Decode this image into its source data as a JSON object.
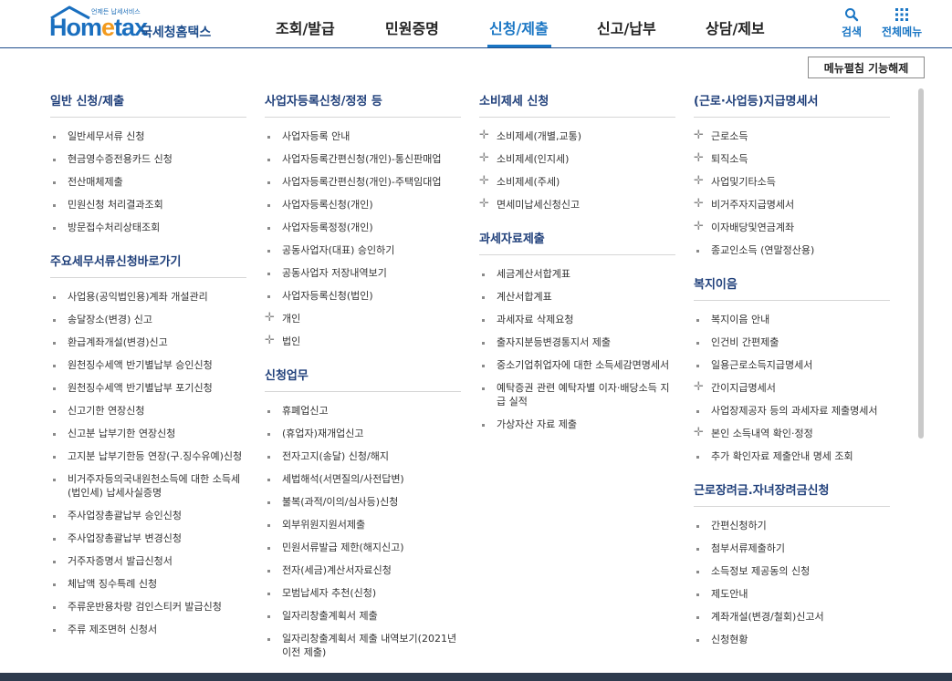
{
  "logo": {
    "tagline": "언제든 납세서비스",
    "word_a": "Hom",
    "word_e": "e",
    "word_b": "tax",
    "name_kr": "국세청홈택스"
  },
  "gnb": {
    "items": [
      "조회/발급",
      "민원증명",
      "신청/제출",
      "신고/납부",
      "상담/제보"
    ],
    "active": "신청/제출"
  },
  "util": {
    "search_label": "검색",
    "allmenu_label": "전체메뉴"
  },
  "close_button": "메뉴펼침 기능해제",
  "colors": {
    "brand": "#1a76c4",
    "section_title": "#1f3f7a"
  },
  "columns": [
    {
      "sections": [
        {
          "title": "일반 신청/제출",
          "items": [
            {
              "label": "일반세무서류 신청",
              "icon": "square-bullet"
            },
            {
              "label": "현금영수증전용카드 신청",
              "icon": "square-bullet"
            },
            {
              "label": "전산매체제출",
              "icon": "square-bullet"
            },
            {
              "label": "민원신청 처리결과조회",
              "icon": "square-bullet"
            },
            {
              "label": "방문접수처리상태조회",
              "icon": "square-bullet"
            }
          ]
        },
        {
          "title": "주요세무서류신청바로가기",
          "items": [
            {
              "label": "사업용(공익법인용)계좌 개설관리",
              "icon": "square-bullet"
            },
            {
              "label": "송달장소(변경) 신고",
              "icon": "square-bullet"
            },
            {
              "label": "환급계좌개설(변경)신고",
              "icon": "square-bullet"
            },
            {
              "label": "원천징수세액 반기별납부 승인신청",
              "icon": "square-bullet"
            },
            {
              "label": "원천징수세액 반기별납부 포기신청",
              "icon": "square-bullet"
            },
            {
              "label": "신고기한 연장신청",
              "icon": "square-bullet"
            },
            {
              "label": "신고분 납부기한 연장신청",
              "icon": "square-bullet"
            },
            {
              "label": "고지분 납부기한등 연장(구.징수유예)신청",
              "icon": "square-bullet"
            },
            {
              "label": "비거주자등의국내원천소득에 대한 소득세(법인세) 납세사실증명",
              "icon": "square-bullet"
            },
            {
              "label": "주사업장총괄납부 승인신청",
              "icon": "square-bullet"
            },
            {
              "label": "주사업장총괄납부 변경신청",
              "icon": "square-bullet"
            },
            {
              "label": "거주자증명서 발급신청서",
              "icon": "square-bullet"
            },
            {
              "label": "체납액 징수특례 신청",
              "icon": "square-bullet"
            },
            {
              "label": "주류운반용차량 검인스티커 발급신청",
              "icon": "square-bullet"
            },
            {
              "label": "주류 제조면허 신청서",
              "icon": "square-bullet"
            }
          ]
        }
      ]
    },
    {
      "sections": [
        {
          "title": "사업자등록신청/정정 등",
          "items": [
            {
              "label": "사업자등록 안내",
              "icon": "square-bullet"
            },
            {
              "label": "사업자등록간편신청(개인)-통신판매업",
              "icon": "square-bullet"
            },
            {
              "label": "사업자등록간편신청(개인)-주택임대업",
              "icon": "square-bullet"
            },
            {
              "label": "사업자등록신청(개인)",
              "icon": "square-bullet"
            },
            {
              "label": "사업자등록정정(개인)",
              "icon": "square-bullet"
            },
            {
              "label": "공동사업자(대표) 승인하기",
              "icon": "square-bullet"
            },
            {
              "label": "공동사업자 저장내역보기",
              "icon": "square-bullet"
            },
            {
              "label": "사업자등록신청(법인)",
              "icon": "square-bullet"
            },
            {
              "label": "개인",
              "icon": "plus-icon"
            },
            {
              "label": "법인",
              "icon": "plus-icon"
            }
          ]
        },
        {
          "title": "신청업무",
          "items": [
            {
              "label": "휴폐업신고",
              "icon": "square-bullet"
            },
            {
              "label": "(휴업자)재개업신고",
              "icon": "square-bullet"
            },
            {
              "label": "전자고지(송달) 신청/해지",
              "icon": "square-bullet"
            },
            {
              "label": "세법해석(서면질의/사전답변)",
              "icon": "square-bullet"
            },
            {
              "label": "불복(과적/이의/심사등)신청",
              "icon": "square-bullet"
            },
            {
              "label": "외부위원지원서제출",
              "icon": "square-bullet"
            },
            {
              "label": "민원서류발급 제한(해지신고)",
              "icon": "square-bullet"
            },
            {
              "label": "전자(세금)계산서자료신청",
              "icon": "square-bullet"
            },
            {
              "label": "모범납세자 추천(신청)",
              "icon": "square-bullet"
            },
            {
              "label": "일자리창출계획서 제출",
              "icon": "square-bullet"
            },
            {
              "label": "일자리창출계획서 제출 내역보기(2021년 이전 제출)",
              "icon": "square-bullet"
            }
          ]
        }
      ]
    },
    {
      "sections": [
        {
          "title": "소비제세 신청",
          "items": [
            {
              "label": "소비제세(개별,교통)",
              "icon": "plus-icon"
            },
            {
              "label": "소비제세(인지세)",
              "icon": "plus-icon"
            },
            {
              "label": "소비제세(주세)",
              "icon": "plus-icon"
            },
            {
              "label": "면세미납세신청신고",
              "icon": "plus-icon"
            }
          ]
        },
        {
          "title": "과세자료제출",
          "items": [
            {
              "label": "세금계산서합계표",
              "icon": "square-bullet"
            },
            {
              "label": "계산서합계표",
              "icon": "square-bullet"
            },
            {
              "label": "과세자료 삭제요청",
              "icon": "square-bullet"
            },
            {
              "label": "출자지분등변경통지서 제출",
              "icon": "square-bullet"
            },
            {
              "label": "중소기업취업자에 대한 소득세감면명세서",
              "icon": "square-bullet"
            },
            {
              "label": "예탁증권 관련 예탁자별 이자·배당소득 지급 실적",
              "icon": "square-bullet"
            },
            {
              "label": "가상자산 자료 제출",
              "icon": "square-bullet"
            }
          ]
        }
      ]
    },
    {
      "sections": [
        {
          "title": "(근로·사업등)지급명세서",
          "items": [
            {
              "label": "근로소득",
              "icon": "plus-icon"
            },
            {
              "label": "퇴직소득",
              "icon": "plus-icon"
            },
            {
              "label": "사업및기타소득",
              "icon": "plus-icon"
            },
            {
              "label": "비거주자지급명세서",
              "icon": "plus-icon"
            },
            {
              "label": "이자배당및연금계좌",
              "icon": "plus-icon"
            },
            {
              "label": "종교인소득 (연말정산용)",
              "icon": "square-bullet"
            }
          ]
        },
        {
          "title": "복지이음",
          "items": [
            {
              "label": "복지이음 안내",
              "icon": "square-bullet"
            },
            {
              "label": "인건비 간편제출",
              "icon": "square-bullet"
            },
            {
              "label": "일용근로소득지급명세서",
              "icon": "square-bullet"
            },
            {
              "label": "간이지급명세서",
              "icon": "plus-icon"
            },
            {
              "label": "사업장제공자 등의 과세자료 제출명세서",
              "icon": "square-bullet"
            },
            {
              "label": "본인 소득내역 확인·정정",
              "icon": "plus-icon"
            },
            {
              "label": "추가 확인자료 제출안내 명세 조회",
              "icon": "square-bullet"
            }
          ]
        },
        {
          "title": "근로장려금.자녀장려금신청",
          "items": [
            {
              "label": "간편신청하기",
              "icon": "square-bullet"
            },
            {
              "label": "첨부서류제출하기",
              "icon": "square-bullet"
            },
            {
              "label": "소득정보 제공동의 신청",
              "icon": "square-bullet"
            },
            {
              "label": "제도안내",
              "icon": "square-bullet"
            },
            {
              "label": "계좌개설(변경/철회)신고서",
              "icon": "square-bullet"
            },
            {
              "label": "신청현황",
              "icon": "square-bullet"
            }
          ]
        }
      ]
    }
  ]
}
